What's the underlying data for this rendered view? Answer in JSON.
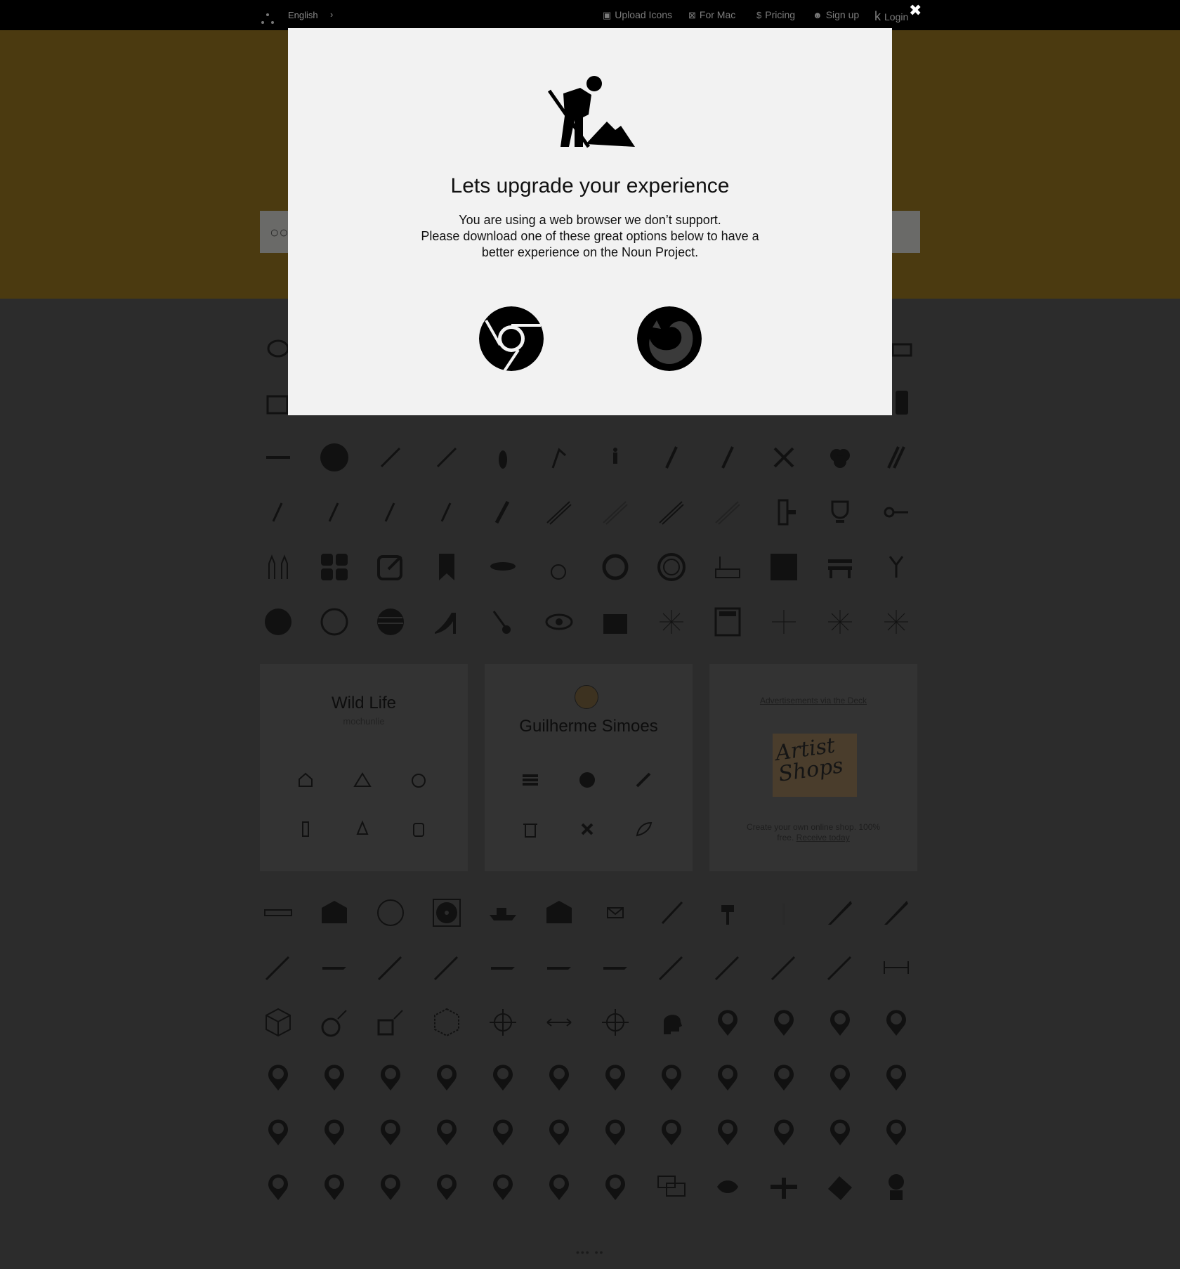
{
  "nav": {
    "language": "English",
    "language_caret": "›",
    "links": [
      "Upload Icons",
      "For Mac",
      "Pricing",
      "Sign up",
      "Login"
    ],
    "icons": [
      "upload-icon",
      "mac-app-icon",
      "dollar-icon",
      "smiley-icon",
      "login-k-icon"
    ]
  },
  "modal": {
    "close_glyph": "✖",
    "title": "Lets upgrade your experience",
    "body_lines": [
      "You are using a web browser we don’t support.",
      "Please download one of these great options below to have a",
      "better experience on the Noun Project."
    ],
    "browsers": [
      "chrome",
      "firefox"
    ]
  },
  "collections": {
    "wild_life": {
      "title": "Wild Life",
      "author": "mochunlie"
    },
    "creator": {
      "name": "Guilherme Simoes"
    },
    "ad": {
      "link": "Advertisements via the Deck",
      "image_text": "Artist Shops",
      "desc": "Create your own online shop. 100% free.",
      "desc_link": "Receive today"
    }
  },
  "pager": "••• ••",
  "colors": {
    "topbar": "#000000",
    "hero_dimmed": "#4b3a10",
    "background_dimmed": "#2c2c2c",
    "modal_bg": "#f2f2f2"
  }
}
